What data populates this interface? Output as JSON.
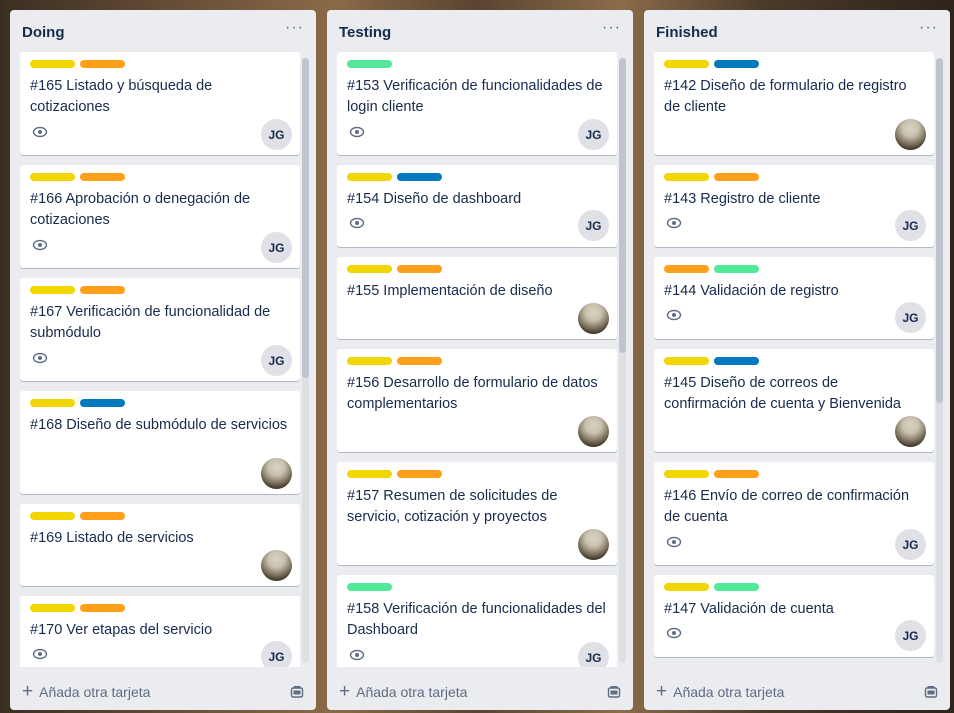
{
  "colors": {
    "yellow": "#f2d600",
    "orange": "#ff9f1a",
    "blue": "#0079bf",
    "green": "#51e898"
  },
  "lists": [
    {
      "title": "Doing",
      "menu": "···",
      "add_label": "Añada otra tarjeta",
      "cards": [
        {
          "labels": [
            "yellow",
            "orange"
          ],
          "title": "#165 Listado y búsqueda de cotizaciones",
          "watch": true,
          "member": "JG"
        },
        {
          "labels": [
            "yellow",
            "orange"
          ],
          "title": "#166 Aprobación o denegación de cotizaciones",
          "watch": true,
          "member": "JG"
        },
        {
          "labels": [
            "yellow",
            "orange"
          ],
          "title": "#167 Verificación de funcionalidad de submódulo",
          "watch": true,
          "member": "JG"
        },
        {
          "labels": [
            "yellow",
            "blue"
          ],
          "title": "#168 Diseño de submódulo de servicios",
          "watch": false,
          "member": "photo"
        },
        {
          "labels": [
            "yellow",
            "orange"
          ],
          "title": "#169 Listado de servicios",
          "watch": false,
          "member": "photo"
        },
        {
          "labels": [
            "yellow",
            "orange"
          ],
          "title": "#170 Ver etapas del servicio",
          "watch": true,
          "member": "JG"
        }
      ]
    },
    {
      "title": "Testing",
      "menu": "···",
      "add_label": "Añada otra tarjeta",
      "cards": [
        {
          "labels": [
            "green"
          ],
          "title": "#153 Verificación de funcionalidades de login cliente",
          "watch": true,
          "member": "JG"
        },
        {
          "labels": [
            "yellow",
            "blue"
          ],
          "title": "#154 Diseño de dashboard",
          "watch": true,
          "member": "JG"
        },
        {
          "labels": [
            "yellow",
            "orange"
          ],
          "title": "#155 Implementación de diseño",
          "watch": false,
          "member": "photo"
        },
        {
          "labels": [
            "yellow",
            "orange"
          ],
          "title": "#156 Desarrollo de formulario de datos complementarios",
          "watch": false,
          "member": "photo"
        },
        {
          "labels": [
            "yellow",
            "orange"
          ],
          "title": "#157 Resumen de solicitudes de servicio, cotización y proyectos",
          "watch": false,
          "member": "photo"
        },
        {
          "labels": [
            "green"
          ],
          "title": "#158 Verificación de funcionalidades del Dashboard",
          "watch": true,
          "member": "JG"
        }
      ]
    },
    {
      "title": "Finished",
      "menu": "···",
      "add_label": "Añada otra tarjeta",
      "cards": [
        {
          "labels": [
            "yellow",
            "blue"
          ],
          "title": "#142 Diseño de formulario de registro de cliente",
          "watch": false,
          "member": "photo"
        },
        {
          "labels": [
            "yellow",
            "orange"
          ],
          "title": "#143 Registro de cliente",
          "watch": true,
          "member": "JG"
        },
        {
          "labels": [
            "orange",
            "green"
          ],
          "title": "#144 Validación de registro",
          "watch": true,
          "member": "JG"
        },
        {
          "labels": [
            "yellow",
            "blue"
          ],
          "title": "#145 Diseño de correos de confirmación de cuenta y Bienvenida",
          "watch": false,
          "member": "photo"
        },
        {
          "labels": [
            "yellow",
            "orange"
          ],
          "title": "#146 Envío de correo de confirmación de cuenta",
          "watch": true,
          "member": "JG"
        },
        {
          "labels": [
            "yellow",
            "green"
          ],
          "title": "#147 Validación de cuenta",
          "watch": true,
          "member": "JG"
        },
        {
          "labels": [
            "yellow",
            "orange"
          ],
          "title": "",
          "watch": false,
          "member": ""
        }
      ]
    }
  ]
}
